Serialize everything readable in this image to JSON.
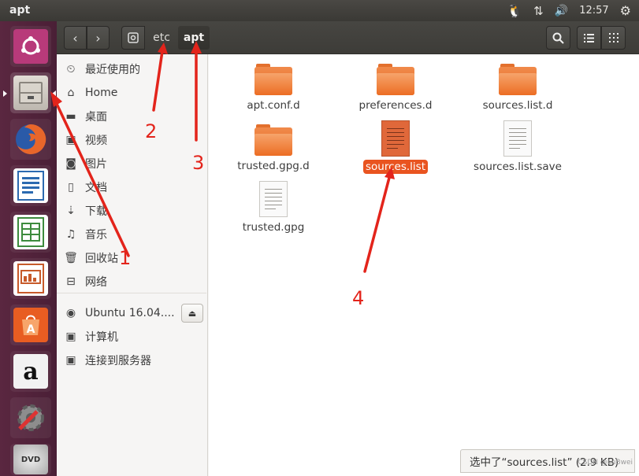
{
  "window": {
    "title": "apt"
  },
  "tray": {
    "network_icon": "network-updown-icon",
    "volume_icon": "volume-icon",
    "time": "12:57",
    "settings_icon": "gear-icon"
  },
  "launcher": {
    "items": [
      {
        "icon": "ubuntu-dash-icon",
        "color": "#b83a7a"
      },
      {
        "icon": "files-icon",
        "color": "#cfcac3"
      },
      {
        "icon": "firefox-icon",
        "color": "#e8662a"
      },
      {
        "icon": "writer-icon",
        "color": "#2c6ab0"
      },
      {
        "icon": "calc-icon",
        "color": "#3d8b3d"
      },
      {
        "icon": "impress-icon",
        "color": "#c75a2a"
      },
      {
        "icon": "software-center-icon",
        "color": "#e85d22"
      },
      {
        "icon": "amazon-icon",
        "color": "#f2f2f2",
        "glyph": "a"
      },
      {
        "icon": "system-settings-icon",
        "color": "#8a8a8a"
      },
      {
        "icon": "dvd-icon",
        "color": "#bdbdbd",
        "glyph": "DVD"
      }
    ]
  },
  "toolbar": {
    "back_icon": "chevron-left-icon",
    "forward_icon": "chevron-right-icon",
    "location_icon": "drive-icon",
    "breadcrumbs": [
      "etc",
      "apt"
    ],
    "search_icon": "search-icon",
    "list_view_icon": "list-view-icon",
    "grid_view_icon": "grid-view-icon"
  },
  "sidebar": {
    "items": [
      {
        "icon": "⏲",
        "label": "最近使用的"
      },
      {
        "icon": "⌂",
        "label": "Home"
      },
      {
        "icon": "▬",
        "label": "桌面"
      },
      {
        "icon": "▣",
        "label": "视频"
      },
      {
        "icon": "◙",
        "label": "图片"
      },
      {
        "icon": "▯",
        "label": "文档"
      },
      {
        "icon": "⇣",
        "label": "下载"
      },
      {
        "icon": "♫",
        "label": "音乐"
      },
      {
        "icon": "🗑",
        "label": "回收站"
      },
      {
        "icon": "⊟",
        "label": "网络"
      }
    ],
    "devices": [
      {
        "icon": "◉",
        "label": "Ubuntu 16.04...."
      },
      {
        "icon": "▣",
        "label": "计算机"
      },
      {
        "icon": "▣",
        "label": "连接到服务器"
      }
    ],
    "eject_icon": "eject-icon"
  },
  "files": [
    {
      "name": "apt.conf.d",
      "kind": "folder"
    },
    {
      "name": "preferences.d",
      "kind": "folder"
    },
    {
      "name": "sources.list.d",
      "kind": "folder"
    },
    {
      "name": "trusted.gpg.d",
      "kind": "folder"
    },
    {
      "name": "sources.list",
      "kind": "text-orange",
      "selected": true
    },
    {
      "name": "sources.list.save",
      "kind": "text"
    },
    {
      "name": "trusted.gpg",
      "kind": "text"
    }
  ],
  "status": {
    "text": "选中了“sources.list” (2.9 KB)"
  },
  "watermark": "CSDN @LuBwei",
  "annotations": {
    "labels": [
      "1",
      "2",
      "3",
      "4"
    ],
    "color": "#e3241b"
  }
}
